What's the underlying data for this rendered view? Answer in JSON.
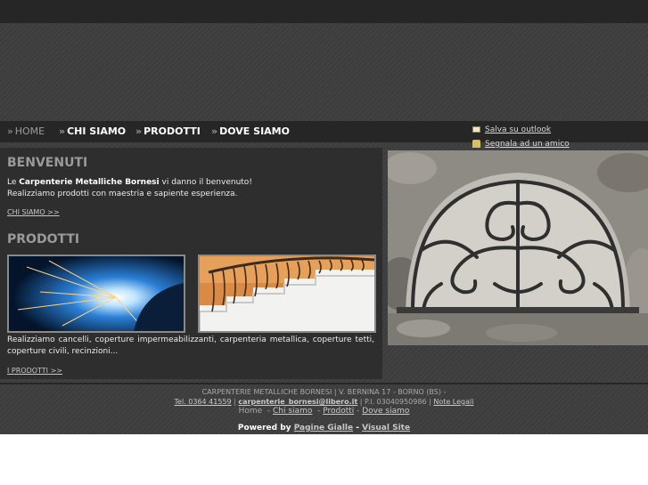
{
  "nav": {
    "home": "HOME",
    "chi_siamo": "CHI SIAMO",
    "prodotti": "PRODOTTI",
    "dove_siamo": "DOVE SIAMO",
    "arrow": "»"
  },
  "quick_links": {
    "outlook": "Salva su outlook",
    "amico": "Segnala ad un amico"
  },
  "benvenuti": {
    "title": "BENVENUTI",
    "line1_prefix": "Le",
    "company": "Carpenterie Metalliche Bornesi",
    "line1_suffix": "vi danno il benvenuto!",
    "line2": "Realizziamo prodotti con maestria e sapiente esperienza.",
    "more": "CHI SIAMO >>"
  },
  "prodotti": {
    "title": "PRODOTTI",
    "text": "Realizziamo cancelli, coperture impermeabilizzanti, carpenteria metallica, coperture tetti, coperture civili, recinzioni...",
    "more": "I PRODOTTI >>"
  },
  "footer": {
    "line1": "CARPENTERIE METALLICHE BORNESI | V. BERNINA 17 - BORNO (BS) -",
    "tel": "Tel. 0364 41559",
    "sep": "|",
    "email": "carpenterie_bornesi@libero.it",
    "piva": "| P.I. 03040950986 |",
    "note": "Note Legali",
    "links": {
      "home": "Home",
      "chi_siamo": "Chi siamo",
      "prodotti": "Prodotti",
      "dove_siamo": "Dove siamo",
      "dash": "-"
    },
    "powered_by": "Powered by",
    "pagine_gialle": "Pagine Gialle",
    "powered_dash": "-",
    "visual_site": "Visual Site"
  },
  "colors": {
    "dark_bar": "#262626",
    "panel": "#2e2e2e",
    "heading": "#9a9a9a"
  }
}
